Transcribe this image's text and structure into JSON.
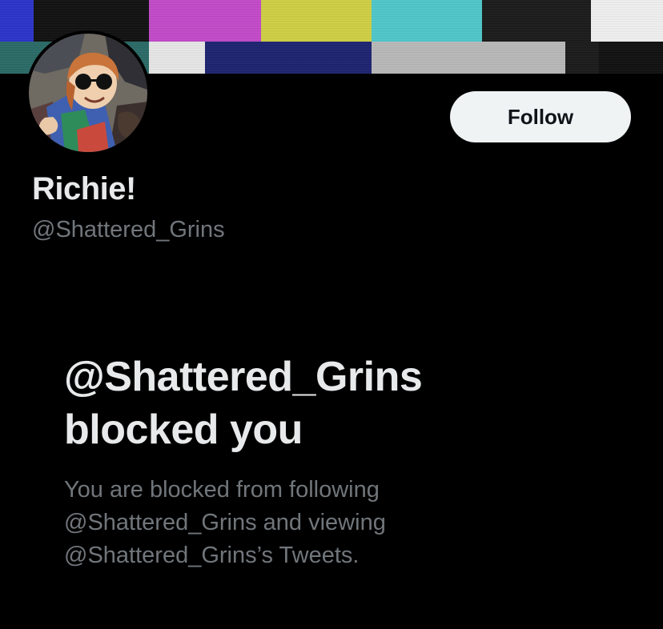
{
  "profile": {
    "display_name": "Richie!",
    "handle": "@Shattered_Grins",
    "follow_label": "Follow"
  },
  "blocked": {
    "title_line1": "@Shattered_Grins",
    "title_line2": "blocked you",
    "description": "You are blocked from following @Shattered_Grins and viewing @Shattered_Grins’s Tweets."
  },
  "colors": {
    "background": "#000000",
    "primary_text": "#e7e9ea",
    "secondary_text": "#71767b",
    "follow_button_bg": "#eff3f4",
    "follow_button_text": "#0f1419"
  },
  "icons": {
    "banner": "tv-color-bars",
    "avatar": "cartoon-avatar-with-sunglasses"
  }
}
